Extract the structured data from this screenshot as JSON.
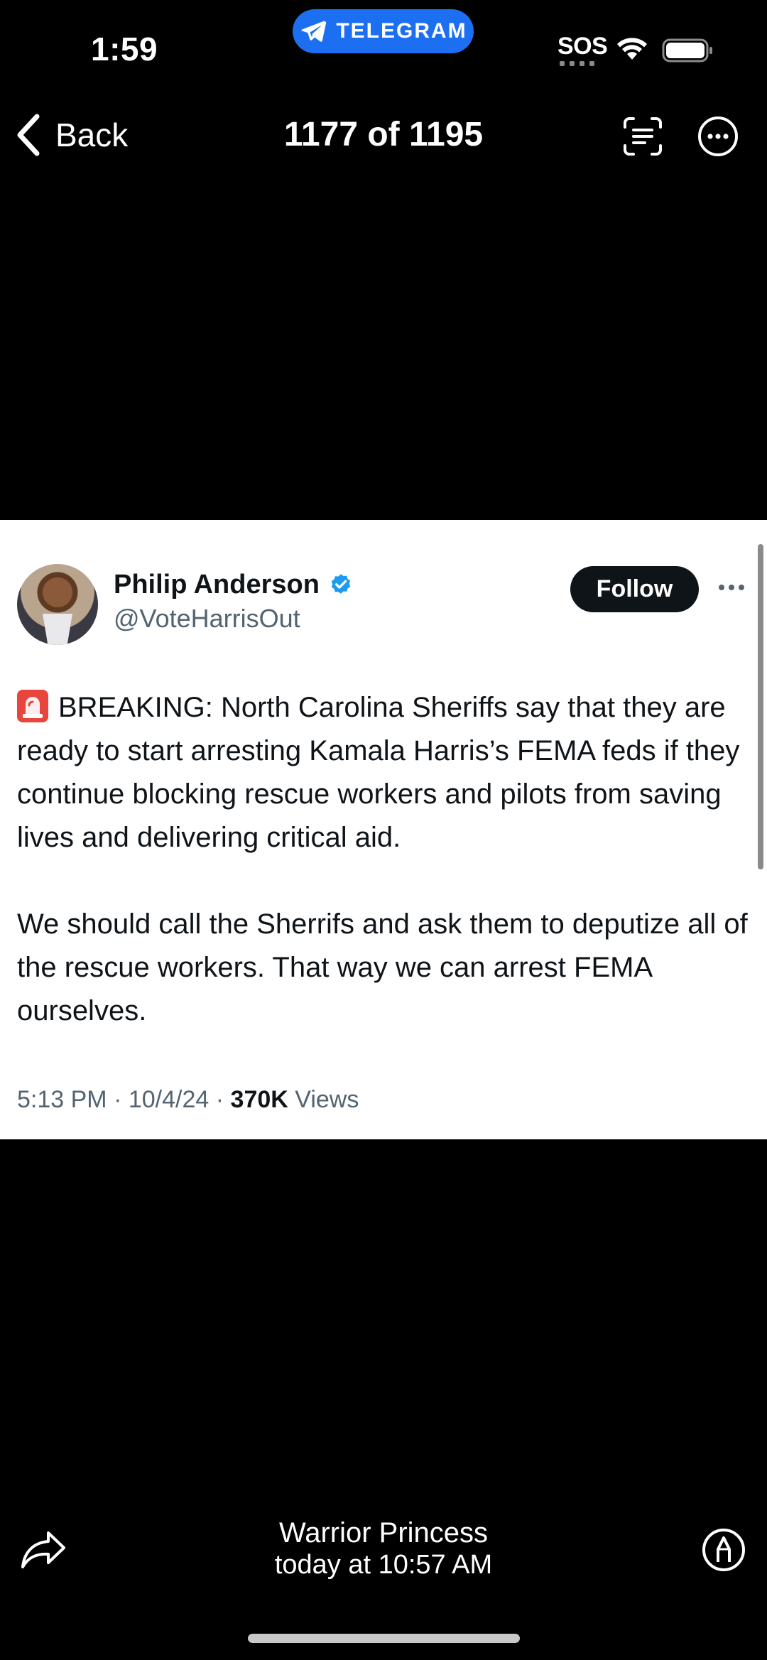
{
  "status_bar": {
    "time": "1:59",
    "return_app": "TELEGRAM",
    "sos": "SOS",
    "icons": [
      "telegram-icon",
      "wifi-icon",
      "battery-icon"
    ]
  },
  "nav": {
    "back_label": "Back",
    "title": "1177 of 1195",
    "icons": [
      "chevron-left-icon",
      "live-text-icon",
      "more-icon"
    ]
  },
  "tweet": {
    "author_name": "Philip Anderson",
    "handle": "@VoteHarrisOut",
    "follow_label": "Follow",
    "paragraph_1": "BREAKING: North Carolina Sheriffs say that they are ready to start arresting Kamala Harris’s FEMA feds if they continue blocking rescue workers and pilots from saving lives and delivering critical aid.",
    "paragraph_2": "We should call the Sherrifs and ask them to deputize all of the rescue workers. That way we can arrest FEMA ourselves.",
    "time": "5:13 PM",
    "date": "10/4/24",
    "views_count": "370K",
    "views_label": "Views",
    "separator": "·",
    "icons": [
      "verified-badge-icon",
      "siren-emoji-icon",
      "more-horizontal-icon"
    ]
  },
  "footer": {
    "sender": "Warrior Princess",
    "sent_time": "today at 10:57 AM",
    "icons": [
      "share-icon",
      "markup-icon"
    ]
  },
  "colors": {
    "background": "#000000",
    "telegram_blue": "#1d6ff2",
    "verified_blue": "#1d9bf0",
    "tweet_text": "#0f1419",
    "tweet_secondary": "#536471"
  }
}
